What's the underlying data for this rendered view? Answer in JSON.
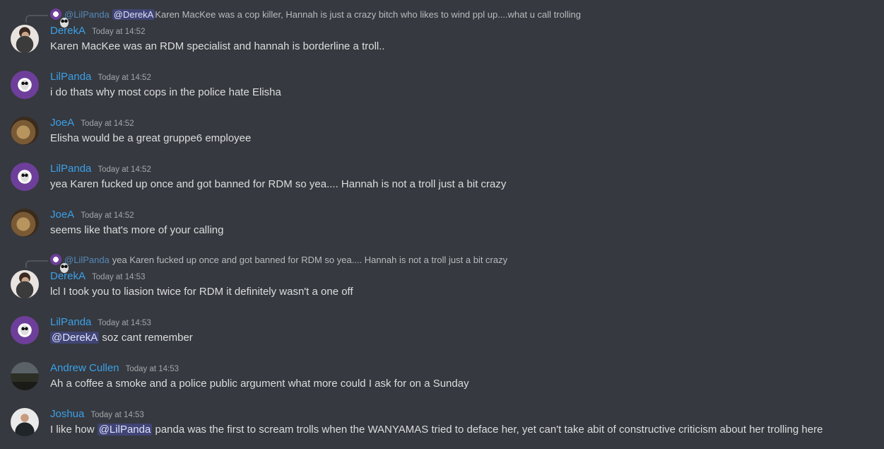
{
  "channel": {
    "theme_bg": "#36393f",
    "username_color": "#3ba0e8",
    "mention_bg": "#4e5597"
  },
  "messages": [
    {
      "reply": {
        "user": "@LilPanda",
        "parts": [
          {
            "mention": "@DerekA"
          },
          {
            "text": "Karen MacKee was a cop killer, Hannah is just a crazy bitch who likes to wind ppl up....what u call trolling"
          }
        ]
      },
      "author": "DerekA",
      "avatar": "derek-avatar",
      "time": "Today at 14:52",
      "content": [
        {
          "text": "Karen MacKee was an RDM specialist and hannah is borderline a troll.."
        }
      ]
    },
    {
      "author": "LilPanda",
      "avatar": "panda-avatar",
      "time": "Today at 14:52",
      "content": [
        {
          "text": "i do thats why most cops in the police hate Elisha"
        }
      ]
    },
    {
      "author": "JoeA",
      "avatar": "joe-avatar",
      "time": "Today at 14:52",
      "content": [
        {
          "text": "Elisha would be a great gruppe6 employee"
        }
      ]
    },
    {
      "author": "LilPanda",
      "avatar": "panda-avatar",
      "time": "Today at 14:52",
      "content": [
        {
          "text": "yea Karen fucked up once and got banned for RDM so yea.... Hannah is not a troll just a bit crazy"
        }
      ]
    },
    {
      "author": "JoeA",
      "avatar": "joe-avatar",
      "time": "Today at 14:52",
      "content": [
        {
          "text": "seems like that's more of your calling"
        }
      ]
    },
    {
      "reply": {
        "user": "@LilPanda",
        "parts": [
          {
            "text": "yea Karen fucked up once and got banned for RDM so yea.... Hannah is not a troll just a bit crazy"
          }
        ]
      },
      "author": "DerekA",
      "avatar": "derek-avatar",
      "time": "Today at 14:53",
      "content": [
        {
          "text": "lcl I took you to liasion twice for RDM it definitely wasn't a one off"
        }
      ]
    },
    {
      "author": "LilPanda",
      "avatar": "panda-avatar",
      "time": "Today at 14:53",
      "content": [
        {
          "mention": "@DerekA"
        },
        {
          "text": " soz cant remember"
        }
      ]
    },
    {
      "author": "Andrew Cullen",
      "avatar": "andrew-avatar",
      "time": "Today at 14:53",
      "content": [
        {
          "text": "Ah a coffee a smoke and a police public argument what more could I ask for on a Sunday"
        }
      ]
    },
    {
      "author": "Joshua",
      "avatar": "joshua-avatar",
      "time": "Today at 14:53",
      "content": [
        {
          "text": "I like how "
        },
        {
          "mention": "@LilPanda"
        },
        {
          "text": " panda was the first to scream trolls when the WANYAMAS tried to deface her, yet can't take abit of constructive criticism about her trolling here"
        }
      ]
    }
  ]
}
